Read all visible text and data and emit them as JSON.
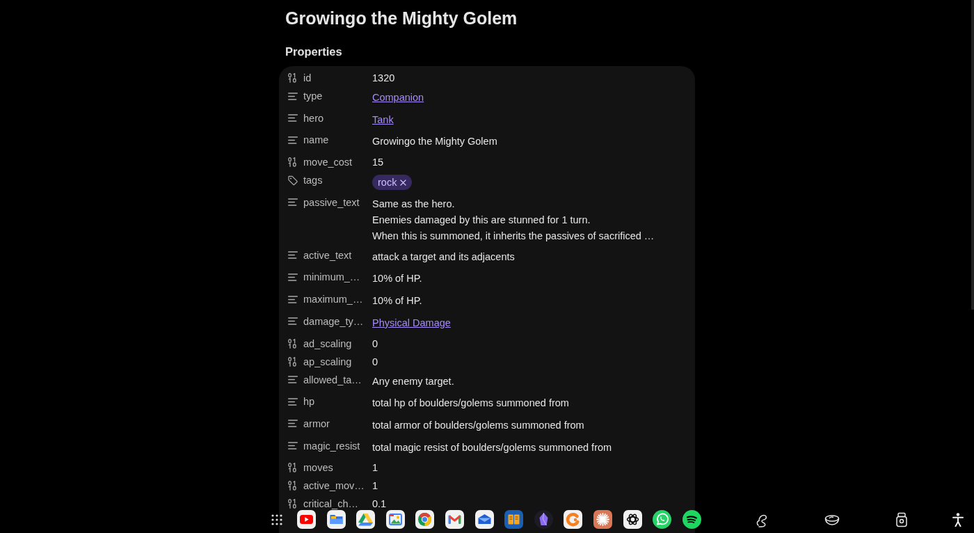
{
  "page": {
    "title": "Growingo the Mighty Golem"
  },
  "properties": {
    "heading": "Properties",
    "rows": [
      {
        "kind": "number",
        "label": "id",
        "value": "1320"
      },
      {
        "kind": "link",
        "label": "type",
        "value": "Companion"
      },
      {
        "kind": "link",
        "label": "hero",
        "value": "Tank"
      },
      {
        "kind": "text",
        "label": "name",
        "value": "Growingo the Mighty Golem"
      },
      {
        "kind": "number",
        "label": "move_cost",
        "value": "15"
      },
      {
        "kind": "tags",
        "label": "tags",
        "tags": [
          "rock"
        ]
      },
      {
        "kind": "text",
        "label": "passive_text",
        "value": "Same as the hero.\nEnemies damaged by this are stunned for 1 turn.\nWhen this is summoned, it inherits the passives of sacrificed …"
      },
      {
        "kind": "text",
        "label": "active_text",
        "value": "attack a target and its adjacents"
      },
      {
        "kind": "text",
        "label": "minimum_…",
        "value": "10% of HP."
      },
      {
        "kind": "text",
        "label": "maximum_…",
        "value": "10% of HP."
      },
      {
        "kind": "link",
        "label": "damage_ty…",
        "value": "Physical Damage"
      },
      {
        "kind": "number",
        "label": "ad_scaling",
        "value": "0"
      },
      {
        "kind": "number",
        "label": "ap_scaling",
        "value": "0"
      },
      {
        "kind": "text",
        "label": "allowed_ta…",
        "value": "Any enemy target."
      },
      {
        "kind": "text",
        "label": "hp",
        "value": "total hp of boulders/golems summoned from"
      },
      {
        "kind": "text",
        "label": "armor",
        "value": "total armor of boulders/golems summoned from"
      },
      {
        "kind": "text",
        "label": "magic_resist",
        "value": "total magic resist of boulders/golems summoned from"
      },
      {
        "kind": "number",
        "label": "moves",
        "value": "1"
      },
      {
        "kind": "number",
        "label": "active_mov…",
        "value": "1"
      },
      {
        "kind": "number",
        "label": "critical_ch…",
        "value": "0.1"
      }
    ]
  }
}
